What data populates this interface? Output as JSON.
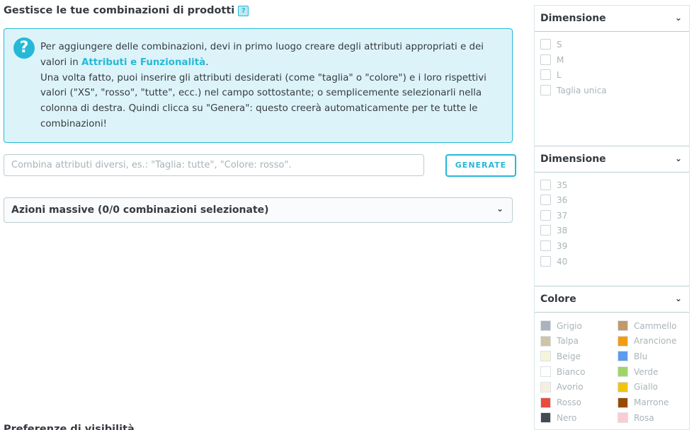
{
  "header": {
    "title": "Gestisce le tue combinazioni di prodotti",
    "help_badge": "?"
  },
  "info": {
    "icon": "?",
    "line1": "Per aggiungere delle combinazioni, devi in primo luogo creare degli attributi appropriati e dei valori in",
    "link": "Attributi e Funzionalità",
    "link_suffix": ".",
    "line2": "Una volta fatto, puoi inserire gli attributi desiderati (come \"taglia\" o \"colore\") e i loro rispettivi valori (\"XS\", \"rosso\", \"tutte\", ecc.) nel campo sottostante; o semplicemente selezionarli nella colonna di destra. Quindi clicca su \"Genera\": questo creerà automaticamente per te tutte le combinazioni!"
  },
  "combine": {
    "placeholder": "Combina attributi diversi, es.: \"Taglia: tutte\", \"Colore: rosso\".",
    "generate_label": "GENERATE"
  },
  "bulk": {
    "label": "Azioni massive (0/0 combinazioni selezionate)",
    "chevron": "⌄"
  },
  "footer": {
    "partial_title": "Preferenze di visibilità"
  },
  "sidebar": {
    "chevron": "⌄",
    "panels": [
      {
        "title": "Dimensione",
        "options": [
          "S",
          "M",
          "L",
          "Taglia unica"
        ]
      },
      {
        "title": "Dimensione",
        "options": [
          "35",
          "36",
          "37",
          "38",
          "39",
          "40"
        ]
      },
      {
        "title": "Colore",
        "colors": [
          {
            "name": "Grigio",
            "hex": "#aab2bd"
          },
          {
            "name": "Cammello",
            "hex": "#c19a6b"
          },
          {
            "name": "Talpa",
            "hex": "#cfc4a6"
          },
          {
            "name": "Arancione",
            "hex": "#f39c11"
          },
          {
            "name": "Beige",
            "hex": "#f5f5dc"
          },
          {
            "name": "Blu",
            "hex": "#5d9cec"
          },
          {
            "name": "Bianco",
            "hex": "#ffffff"
          },
          {
            "name": "Verde",
            "hex": "#a0d468"
          },
          {
            "name": "Avorio",
            "hex": "#f6efe0"
          },
          {
            "name": "Giallo",
            "hex": "#f1c40f"
          },
          {
            "name": "Rosso",
            "hex": "#e84c3d"
          },
          {
            "name": "Marrone",
            "hex": "#964b00"
          },
          {
            "name": "Nero",
            "hex": "#434a54"
          },
          {
            "name": "Rosa",
            "hex": "#fcccd1"
          }
        ]
      }
    ]
  }
}
